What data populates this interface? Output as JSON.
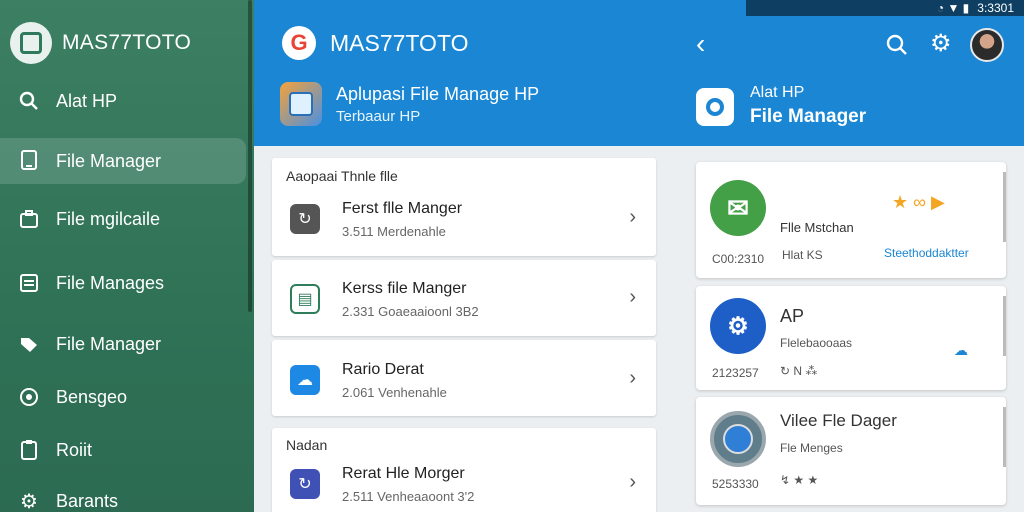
{
  "statusbar": {
    "signal": "◔ ▼ ▮",
    "time": "3:3301"
  },
  "sidebar": {
    "brand": "MAS77TOTO",
    "items": [
      {
        "label": "Alat HP",
        "icon": "search-icon"
      },
      {
        "label": "File Manager",
        "icon": "phone-icon"
      },
      {
        "label": "File mgilcaile",
        "icon": "briefcase-icon"
      },
      {
        "label": "File Manages",
        "icon": "document-icon"
      },
      {
        "label": "File Manager",
        "icon": "tag-icon"
      },
      {
        "label": "Bensgeo",
        "icon": "circle-icon"
      },
      {
        "label": "Roiit",
        "icon": "clipboard-icon"
      },
      {
        "label": "Barants",
        "icon": "gear-icon"
      }
    ]
  },
  "header": {
    "title": "MAS77TOTO",
    "g_letter": "G",
    "back": "‹",
    "gear": "⚙",
    "app": {
      "title": "Aplupasi File Manage HP",
      "subtitle": "Terbaaur HP"
    },
    "right_app": {
      "title": "Alat HP",
      "subtitle": "File Manager"
    }
  },
  "list": {
    "section1": "Aaopaai  Thnle flle",
    "section2": "Nadan",
    "items": [
      {
        "title": "Ferst flle Manger",
        "meta": "3.511   Merdenahle",
        "icon_color": "#555555",
        "icon": "refresh-icon"
      },
      {
        "title": "Kerss file Manger",
        "meta": "2.331   Goaeaaioonl 3B2",
        "icon_color": "#2e7d5b",
        "icon": "folder-icon"
      },
      {
        "title": "Rario Derat",
        "meta": "2.061   Venhenahle",
        "icon_color": "#1e88e5",
        "icon": "cloud-icon"
      },
      {
        "title": "Rerat Hle Morger",
        "meta": "2.511   Venheaaoont 3'2",
        "icon_color": "#3f51b5",
        "icon": "refresh-icon"
      }
    ],
    "chevron": "›"
  },
  "cards": [
    {
      "title": "Flle Mstchan",
      "code": "C00:2310",
      "meta": "Hlat KS",
      "link": "Steethoddaktter",
      "icon": "mail-icon",
      "icon_color": "#43a047",
      "extra": "★ ∞ ▶"
    },
    {
      "title": "AP",
      "subtitle": "Flelebaooaas",
      "code": "2123257",
      "meta": "↻ N ⁂",
      "icon": "settings-icon",
      "icon_color": "#1e5fc7",
      "extra": ""
    },
    {
      "title": "Vilee Fle Dager",
      "subtitle": "Fle Menges",
      "code": "5253330",
      "meta": "↯ ★ ★",
      "icon": "watch-icon",
      "icon_color": "#607d8b",
      "extra": ""
    }
  ]
}
